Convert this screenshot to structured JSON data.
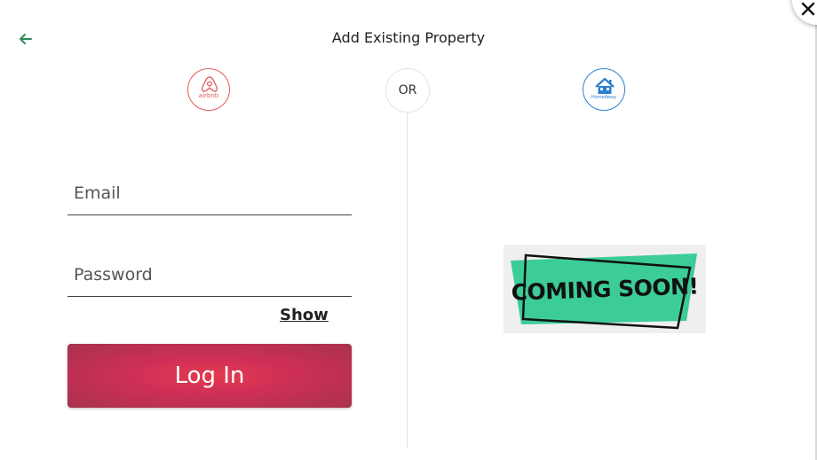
{
  "header": {
    "title": "Add Existing Property"
  },
  "providers": {
    "airbnb": {
      "name": "airbnb",
      "color": "#e05a5a"
    },
    "separator": "OR",
    "homeaway": {
      "name": "HomeAway",
      "color": "#2a7fd0"
    }
  },
  "login_form": {
    "email_placeholder": "Email",
    "email_value": "",
    "password_placeholder": "Password",
    "password_value": "",
    "show_label": "Show",
    "login_label": "Log In"
  },
  "coming_soon": {
    "text": "COMING SOON!",
    "accent": "#3ccc97"
  },
  "colors": {
    "login_button": "#d42f52",
    "back_arrow": "#2e8b57"
  }
}
